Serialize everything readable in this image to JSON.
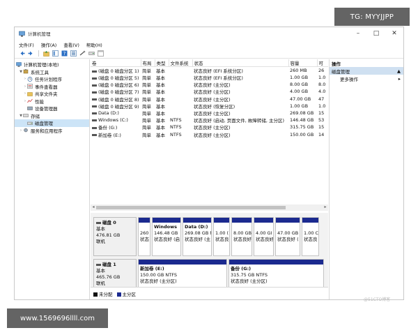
{
  "window": {
    "title": "计算机管理",
    "min": "–",
    "max": "□",
    "close": "✕"
  },
  "menu": [
    "文件(F)",
    "操作(A)",
    "查看(V)",
    "帮助(H)"
  ],
  "tree": {
    "root": "计算机管理(本地)",
    "system_tools": "系统工具",
    "task_scheduler": "任务计划程序",
    "event_viewer": "事件查看器",
    "shared_folders": "共享文件夹",
    "performance": "性能",
    "device_manager": "设备管理器",
    "storage": "存储",
    "disk_management": "磁盘管理",
    "services_apps": "服务和应用程序"
  },
  "volume_list": {
    "headers": [
      "卷",
      "布局",
      "类型",
      "文件系统",
      "状态",
      "容量",
      "可"
    ],
    "rows": [
      [
        "(磁盘 0 磁盘分区 1)",
        "简单",
        "基本",
        "",
        "状态良好 (EFI 系统分区)",
        "260 MB",
        "26"
      ],
      [
        "(磁盘 0 磁盘分区 5)",
        "简单",
        "基本",
        "",
        "状态良好 (EFI 系统分区)",
        "1.00 GB",
        "1.0"
      ],
      [
        "(磁盘 0 磁盘分区 6)",
        "简单",
        "基本",
        "",
        "状态良好 (主分区)",
        "8.00 GB",
        "8.0"
      ],
      [
        "(磁盘 0 磁盘分区 7)",
        "简单",
        "基本",
        "",
        "状态良好 (主分区)",
        "4.00 GB",
        "4.0"
      ],
      [
        "(磁盘 0 磁盘分区 8)",
        "简单",
        "基本",
        "",
        "状态良好 (主分区)",
        "47.00 GB",
        "47"
      ],
      [
        "(磁盘 0 磁盘分区 9)",
        "简单",
        "基本",
        "",
        "状态良好 (恢复分区)",
        "1.00 GB",
        "1.0"
      ],
      [
        "Data (D:)",
        "简单",
        "基本",
        "",
        "状态良好 (主分区)",
        "269.08 GB",
        "15"
      ],
      [
        "Windows (C:)",
        "简单",
        "基本",
        "NTFS",
        "状态良好 (启动, 页面文件, 故障转储, 主分区)",
        "146.48 GB",
        "53"
      ],
      [
        "备份 (G:)",
        "简单",
        "基本",
        "NTFS",
        "状态良好 (主分区)",
        "315.75 GB",
        "15"
      ],
      [
        "新加卷 (E:)",
        "简单",
        "基本",
        "NTFS",
        "状态良好 (主分区)",
        "150.00 GB",
        "14"
      ]
    ]
  },
  "disk0": {
    "name": "磁盘 0",
    "type": "基本",
    "size": "476.81 GB",
    "status": "联机",
    "partitions": [
      {
        "name": "",
        "size": "260",
        "status": "状态"
      },
      {
        "name": "Windows",
        "size": "146.48 GB",
        "status": "状态良好 (启"
      },
      {
        "name": "Data  (D:)",
        "size": "269.08 GB N",
        "status": "状态良好 (主"
      },
      {
        "name": "",
        "size": "1.00 (",
        "status": "状态良"
      },
      {
        "name": "",
        "size": "8.00 GB",
        "status": "状态良好"
      },
      {
        "name": "",
        "size": "4.00 GI",
        "status": "状态良好"
      },
      {
        "name": "",
        "size": "47.00 GB",
        "status": "状态良好 ("
      },
      {
        "name": "",
        "size": "1.00 C",
        "status": "状态良"
      }
    ]
  },
  "disk1": {
    "name": "磁盘 1",
    "type": "基本",
    "size": "465.76 GB",
    "status": "联机",
    "partitions": [
      {
        "name": "新加卷  (E:)",
        "size": "150.00 GB NTFS",
        "status": "状态良好 (主分区)"
      },
      {
        "name": "备份  (G:)",
        "size": "315.75 GB NTFS",
        "status": "状态良好 (主分区)"
      }
    ]
  },
  "legend": {
    "unallocated": "未分配",
    "primary": "主分区",
    "unallocated_color": "#111111",
    "primary_color": "#1b2a8f"
  },
  "actions": {
    "header": "操作",
    "section": "磁盘管理",
    "more": "更多操作"
  },
  "watermarks": {
    "top": "TG: MYYJJPP",
    "bottom": "www.1569696llll.com",
    "small": "@51CTO博客"
  }
}
